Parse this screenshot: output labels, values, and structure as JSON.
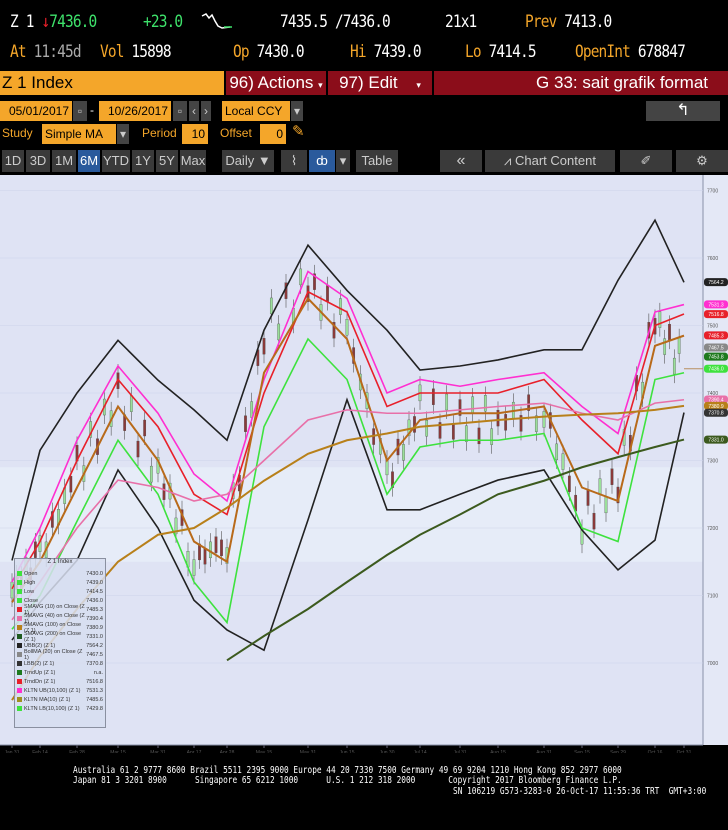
{
  "quote": {
    "ticker": "Z 1",
    "last": "7436.0",
    "change": "+23.0",
    "bid_ask": "7435.5 /7436.0",
    "size": "21x1",
    "prev_label": "Prev",
    "prev": "7413.0",
    "at_label": "At",
    "time": "11:45d",
    "vol_label": "Vol",
    "vol": "15898",
    "op_label": "Op",
    "open": "7430.0",
    "hi_label": "Hi",
    "high": "7439.0",
    "lo_label": "Lo",
    "low": "7414.5",
    "oi_label": "OpenInt",
    "open_int": "678847"
  },
  "bar": {
    "security": "Z 1 Index",
    "actions": "96) Actions",
    "edit": "97) Edit",
    "title": "G 33: sait grafik format"
  },
  "range": {
    "start": "05/01/2017",
    "end": "10/26/2017",
    "currency": "Local CCY"
  },
  "study": {
    "label": "Study",
    "value": "Simple MA",
    "period_label": "Period",
    "period": "10",
    "offset_label": "Offset",
    "offset": "0"
  },
  "toolbar": {
    "periods": [
      "1D",
      "3D",
      "1M",
      "6M",
      "YTD",
      "1Y",
      "5Y",
      "Max"
    ],
    "active": "6M",
    "frequency": "Daily ▼",
    "table": "Table",
    "collapse": "«",
    "chart_content": "Chart Content"
  },
  "colors": {
    "orange": "#f4a62a",
    "darkred": "#8b0d1a",
    "plot_bg": "#dfe3f4"
  },
  "chart_data": {
    "type": "line",
    "x": [
      "Jan 31",
      "Feb 14",
      "Feb 28",
      "Mar 15",
      "Mar 31",
      "Apr 17",
      "Apr 28",
      "May 15",
      "May 31",
      "Jun 15",
      "Jun 30",
      "Jul 14",
      "Jul 31",
      "Aug 15",
      "Aug 31",
      "Sep 15",
      "Sep 29",
      "Oct 16",
      "Oct 31"
    ],
    "year_label": "2017",
    "y_ticks": [
      7000,
      7100,
      7200,
      7300,
      7400,
      7500,
      7600,
      7700
    ],
    "ylim": [
      6880,
      7730
    ],
    "series": [
      {
        "key": "close",
        "color": "#2e8b2e",
        "values": [
          7108,
          7160,
          7286,
          7397,
          7286,
          7152,
          7182,
          7493,
          7560,
          7493,
          7271,
          7375,
          7360,
          7360,
          7375,
          7212,
          7271,
          7508,
          7436
        ]
      },
      {
        "key": "ubb",
        "color": "#222222",
        "values": [
          7152,
          7315,
          7400,
          7478,
          7419,
          7375,
          7330,
          7493,
          7619,
          7552,
          7493,
          7434,
          7440,
          7449,
          7464,
          7464,
          7567,
          7656,
          7564
        ]
      },
      {
        "key": "lbb",
        "color": "#222222",
        "values": [
          7034,
          7090,
          7152,
          7286,
          7200,
          7093,
          7049,
          7019,
          7212,
          7390,
          7227,
          7227,
          7250,
          7271,
          7286,
          7197,
          7138,
          7182,
          7371
        ]
      },
      {
        "key": "kltn_ub",
        "color": "#ff2fd0",
        "values": [
          7120,
          7200,
          7330,
          7440,
          7370,
          7280,
          7240,
          7420,
          7580,
          7540,
          7400,
          7420,
          7410,
          7420,
          7430,
          7380,
          7340,
          7520,
          7531
        ]
      },
      {
        "key": "trnd_dn",
        "color": "#e8202a",
        "values": [
          7110,
          7180,
          7300,
          7420,
          7350,
          7250,
          7220,
          7400,
          7550,
          7520,
          7380,
          7400,
          7400,
          7400,
          7420,
          7360,
          7310,
          7500,
          7517
        ]
      },
      {
        "key": "sma10",
        "color": "#b86a1a",
        "values": [
          7090,
          7150,
          7260,
          7380,
          7300,
          7180,
          7150,
          7430,
          7540,
          7480,
          7300,
          7360,
          7370,
          7370,
          7380,
          7260,
          7240,
          7470,
          7485
        ]
      },
      {
        "key": "kltn_lb",
        "color": "#3ee23e",
        "values": [
          7050,
          7100,
          7210,
          7330,
          7250,
          7120,
          7060,
          7350,
          7480,
          7420,
          7250,
          7320,
          7330,
          7330,
          7340,
          7200,
          7180,
          7420,
          7430
        ]
      },
      {
        "key": "sma40",
        "color": "#e870a8",
        "values": [
          7064,
          7120,
          7200,
          7271,
          7260,
          7240,
          7250,
          7300,
          7360,
          7375,
          7370,
          7370,
          7375,
          7380,
          7385,
          7370,
          7360,
          7385,
          7390
        ]
      },
      {
        "key": "sma100",
        "color": "#b8801a",
        "values": [
          6945,
          7010,
          7080,
          7150,
          7190,
          7200,
          7230,
          7270,
          7310,
          7330,
          7340,
          7350,
          7355,
          7360,
          7365,
          7368,
          7370,
          7375,
          7381
        ]
      },
      {
        "key": "sma200",
        "color": "#3c5a1e",
        "values": [
          null,
          null,
          null,
          null,
          null,
          null,
          7004,
          7040,
          7080,
          7120,
          7160,
          7190,
          7220,
          7250,
          7270,
          7290,
          7305,
          7320,
          7331
        ]
      }
    ],
    "price_tags": [
      {
        "value": "7564.2",
        "color": "#222222"
      },
      {
        "value": "7531.3",
        "color": "#ff2fd0"
      },
      {
        "value": "7516.8",
        "color": "#e8202a"
      },
      {
        "value": "7485.3",
        "color": "#e8202a"
      },
      {
        "value": "7467.5",
        "color": "#888888"
      },
      {
        "value": "7453.8",
        "color": "#1e7a1e"
      },
      {
        "value": "7436.0",
        "color": "#3ee23e"
      },
      {
        "value": "7390.4",
        "color": "#e870a8"
      },
      {
        "value": "7380.9",
        "color": "#b8801a"
      },
      {
        "value": "7370.8",
        "color": "#333333"
      },
      {
        "value": "7331.0",
        "color": "#3c5a1e"
      }
    ]
  },
  "legend": {
    "title": "Z 1 Index",
    "rows": [
      {
        "name": "Open",
        "value": "7430.0",
        "color": "#3ee23e"
      },
      {
        "name": "High",
        "value": "7439.0",
        "color": "#3ee23e"
      },
      {
        "name": "Low",
        "value": "7414.5",
        "color": "#3ee23e"
      },
      {
        "name": "Close",
        "value": "7436.0",
        "color": "#3ee23e"
      },
      {
        "name": "SMAVG (10) on Close (Z 1)",
        "value": "7485.3",
        "color": "#e8202a"
      },
      {
        "name": "SMAVG (40) on Close (Z 1)",
        "value": "7390.4",
        "color": "#e870a8"
      },
      {
        "name": "SMAVG (100) on Close (Z 1)",
        "value": "7380.9",
        "color": "#b8801a"
      },
      {
        "name": "SMAVG (200) on Close (Z 1)",
        "value": "7331.0",
        "color": "#1e5a1e"
      },
      {
        "name": "UBB(2) (Z 1)",
        "value": "7564.2",
        "color": "#222222"
      },
      {
        "name": "BollMA (20) on Close (Z 1)",
        "value": "7467.5",
        "color": "#888888"
      },
      {
        "name": "LBB(2) (Z 1)",
        "value": "7370.8",
        "color": "#333333"
      },
      {
        "name": "TrndUp (Z 1)",
        "value": "n.a.",
        "color": "#1e7a1e"
      },
      {
        "name": "TrndDn (Z 1)",
        "value": "7516.8",
        "color": "#e8202a"
      },
      {
        "name": "KLTN UB(10,100) (Z 1)",
        "value": "7531.3",
        "color": "#ff2fd0"
      },
      {
        "name": "KLTN MA(10) (Z 1)",
        "value": "7485.6",
        "color": "#a09020"
      },
      {
        "name": "KLTN LB(10,100) (Z 1)",
        "value": "7429.8",
        "color": "#3ee23e"
      }
    ]
  },
  "footer": {
    "line1": "Australia 61 2 9777 8600 Brazil 5511 2395 9000 Europe 44 20 7330 7500 Germany 49 69 9204 1210 Hong Kong 852 2977 6000",
    "line2": "Japan 81 3 3201 8900      Singapore 65 6212 1000      U.S. 1 212 318 2000       Copyright 2017 Bloomberg Finance L.P.",
    "line3": "SN 106219 G573-3283-0 26-Oct-17 11:55:36 TRT  GMT+3:00"
  }
}
